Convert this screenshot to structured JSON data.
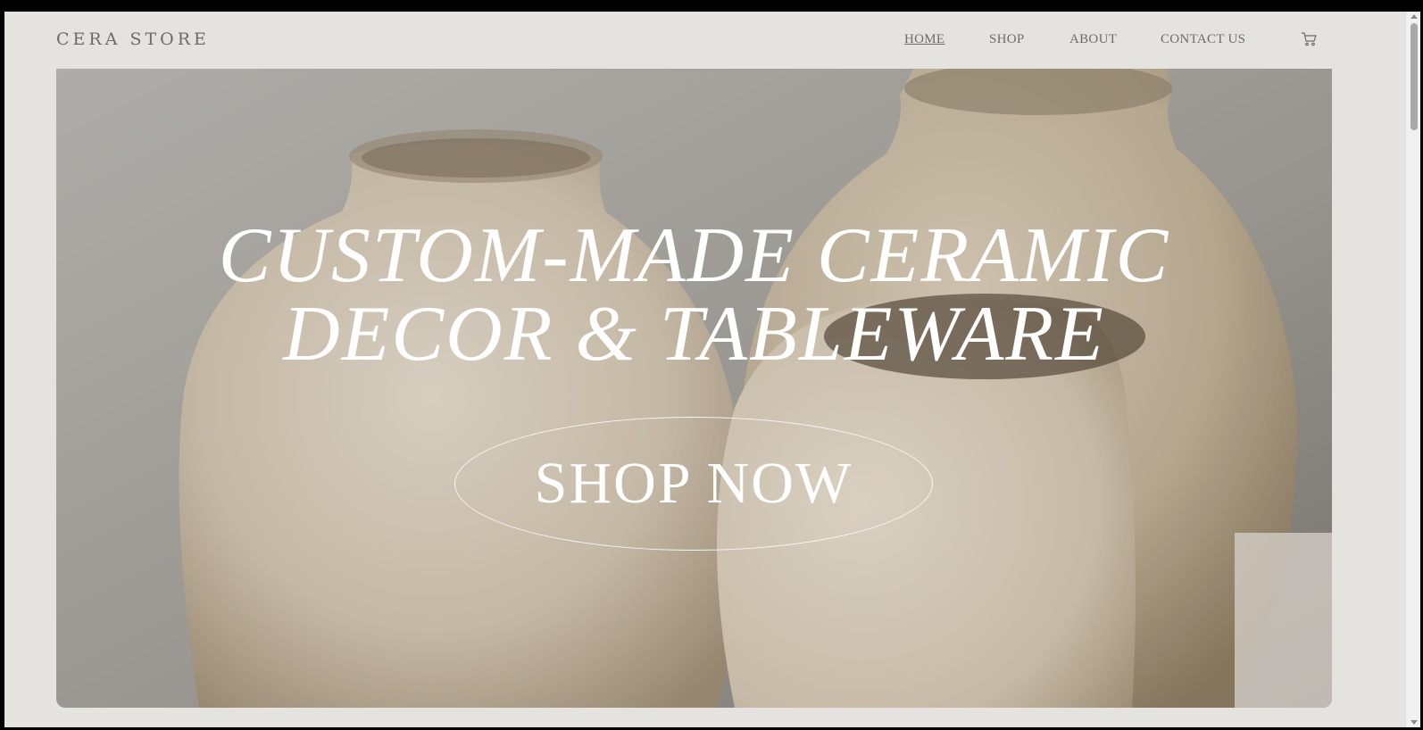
{
  "header": {
    "logo": "CERA  STORE",
    "nav": [
      {
        "label": "HOME",
        "active": true
      },
      {
        "label": "SHOP",
        "active": false
      },
      {
        "label": "ABOUT",
        "active": false
      },
      {
        "label": "CONTACT US",
        "active": false
      }
    ],
    "cart_icon": "cart-icon"
  },
  "hero": {
    "headline_line1": "CUSTOM-MADE CERAMIC",
    "headline_line2": "DECOR & TABLEWARE",
    "cta_label": "SHOP NOW"
  },
  "colors": {
    "page_bg": "#e5e3df",
    "nav_text": "#6f6c68",
    "hero_text": "#ffffff"
  }
}
